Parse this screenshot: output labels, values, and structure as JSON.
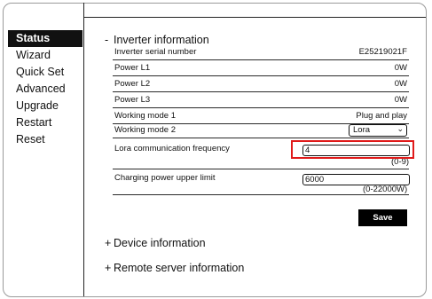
{
  "nav": {
    "items": [
      {
        "label": "Status"
      },
      {
        "label": "Wizard"
      },
      {
        "label": "Quick Set"
      },
      {
        "label": "Advanced"
      },
      {
        "label": "Upgrade"
      },
      {
        "label": "Restart"
      },
      {
        "label": "Reset"
      }
    ]
  },
  "inverter": {
    "sign": "-",
    "title": "Inverter information",
    "rows": [
      {
        "label": "Inverter serial number",
        "value": "E25219021F"
      },
      {
        "label": "Power L1",
        "value": "0W"
      },
      {
        "label": "Power L2",
        "value": "0W"
      },
      {
        "label": "Power L3",
        "value": "0W"
      },
      {
        "label": "Working mode 1",
        "value": "Plug and play"
      }
    ],
    "working_mode_2": {
      "label": "Working mode 2",
      "selected": "Lora"
    },
    "lora": {
      "label": "Lora communication frequency",
      "value": "4",
      "range": "(0-9)"
    },
    "charging": {
      "label": "Charging power upper limit",
      "value": "6000",
      "range": "(0-22000W)"
    },
    "save_label": "Save"
  },
  "device": {
    "sign": "+",
    "title": "Device information"
  },
  "remote": {
    "sign": "+",
    "title": "Remote server information"
  }
}
